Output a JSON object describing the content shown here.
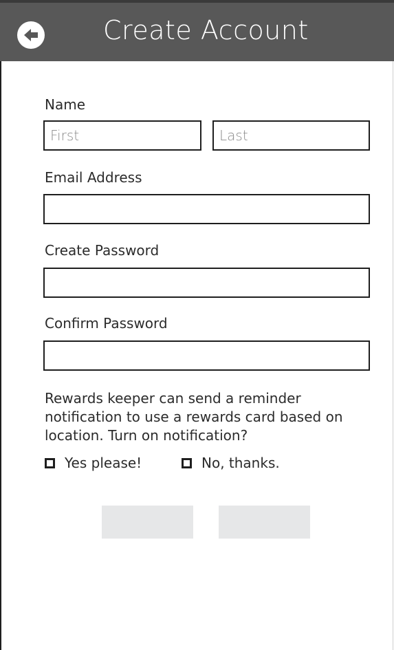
{
  "header": {
    "title": "Create Account",
    "back_icon": "arrow-left-icon"
  },
  "form": {
    "name_label": "Name",
    "first_placeholder": "First",
    "last_placeholder": "Last",
    "first_value": "",
    "last_value": "",
    "email_label": "Email Address",
    "email_value": "",
    "password_label": "Create Password",
    "password_value": "",
    "confirm_label": "Confirm Password",
    "confirm_value": ""
  },
  "notification": {
    "prompt_line1": "Rewards keeper can send a reminder",
    "prompt_line2": "notification to use a rewards card based on",
    "prompt_line3": "location. Turn on notification?",
    "option_yes": "Yes please!",
    "option_no": "No, thanks.",
    "yes_checked": false,
    "no_checked": false
  },
  "colors": {
    "header_bg": "#585858",
    "button_bg": "#e6e7e8",
    "border": "#1e1e1e"
  }
}
